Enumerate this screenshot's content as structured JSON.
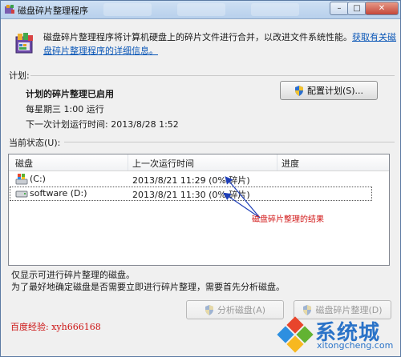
{
  "window": {
    "title": "磁盘碎片整理程序",
    "controls": {
      "minimize": "–",
      "maximize": "□",
      "close": "✕"
    }
  },
  "intro": {
    "text": "磁盘碎片整理程序将计算机硬盘上的碎片文件进行合并，以改进文件系统性能。",
    "link": "获取有关磁盘碎片整理程序的详细信息。"
  },
  "schedule": {
    "section_label": "计划:",
    "status": "计划的碎片整理已启用",
    "run_time": "每星期三  1:00 运行",
    "next_run": "下一次计划运行时间: 2013/8/28 1:52",
    "configure_button": "配置计划(S)..."
  },
  "current_status": {
    "section_label": "当前状态(U):",
    "columns": [
      "磁盘",
      "上一次运行时间",
      "进度"
    ],
    "rows": [
      {
        "disk": "(C:)",
        "last_run": "2013/8/21 11:29 (0% 碎片)",
        "progress": ""
      },
      {
        "disk": "software (D:)",
        "last_run": "2013/8/21 11:30 (0% 碎片)",
        "progress": ""
      }
    ],
    "annotation": "磁盘碎片整理的结果"
  },
  "footer": {
    "note1": "仅显示可进行碎片整理的磁盘。",
    "note2": "为了最好地确定磁盘是否需要立即进行碎片整理，需要首先分析磁盘。",
    "analyze_button": "分析磁盘(A)",
    "defrag_button": "磁盘碎片整理(D)"
  },
  "watermark": {
    "text": "百度经验: xyh666168",
    "logo_cn": "系统城",
    "logo_en": "xitongcheng.com"
  },
  "colors": {
    "accent": "#0b57b7",
    "annotation": "#d11515",
    "arrow": "#1f3fb8",
    "logo": "#2a73c8"
  }
}
